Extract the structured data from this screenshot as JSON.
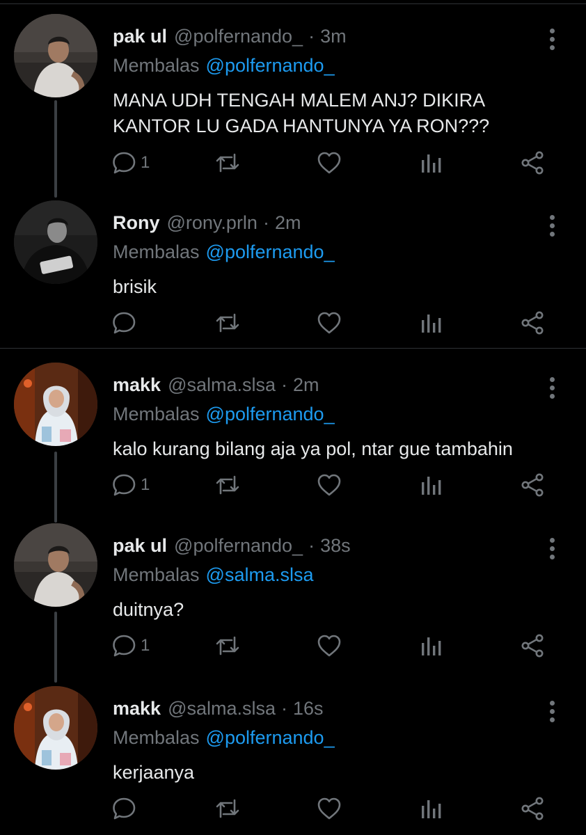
{
  "theme": {
    "background": "#000000",
    "text": "#e7e9ea",
    "muted": "#71767b",
    "accent": "#1d9bf0",
    "divider": "#2f3336"
  },
  "tweets": [
    {
      "name": "pak ul",
      "handle": "@polfernando_",
      "dot": "·",
      "time": "3m",
      "reply_prefix": "Membalas",
      "reply_to": "@polfernando_",
      "text": "MANA UDH TENGAH MALEM ANJ? DIKIRA KANTOR LU GADA HANTUNYA YA RON???",
      "reply_count": "1",
      "avatar_icon": "avatar-photo-man-leaning"
    },
    {
      "name": "Rony",
      "handle": "@rony.prln",
      "dot": "·",
      "time": "2m",
      "reply_prefix": "Membalas",
      "reply_to": "@polfernando_",
      "text": "brisik",
      "reply_count": "",
      "avatar_icon": "avatar-photo-man-bw"
    },
    {
      "name": "makk",
      "handle": "@salma.slsa",
      "dot": "·",
      "time": "2m",
      "reply_prefix": "Membalas",
      "reply_to": "@polfernando_",
      "text": "kalo kurang bilang aja ya pol, ntar gue tambahin",
      "reply_count": "1",
      "avatar_icon": "avatar-photo-woman-hijab"
    },
    {
      "name": "pak ul",
      "handle": "@polfernando_",
      "dot": "·",
      "time": "38s",
      "reply_prefix": "Membalas",
      "reply_to": "@salma.slsa",
      "text": "duitnya?",
      "reply_count": "1",
      "avatar_icon": "avatar-photo-man-leaning"
    },
    {
      "name": "makk",
      "handle": "@salma.slsa",
      "dot": "·",
      "time": "16s",
      "reply_prefix": "Membalas",
      "reply_to": "@polfernando_",
      "text": "kerjaanya",
      "reply_count": "",
      "avatar_icon": "avatar-photo-woman-hijab"
    }
  ]
}
